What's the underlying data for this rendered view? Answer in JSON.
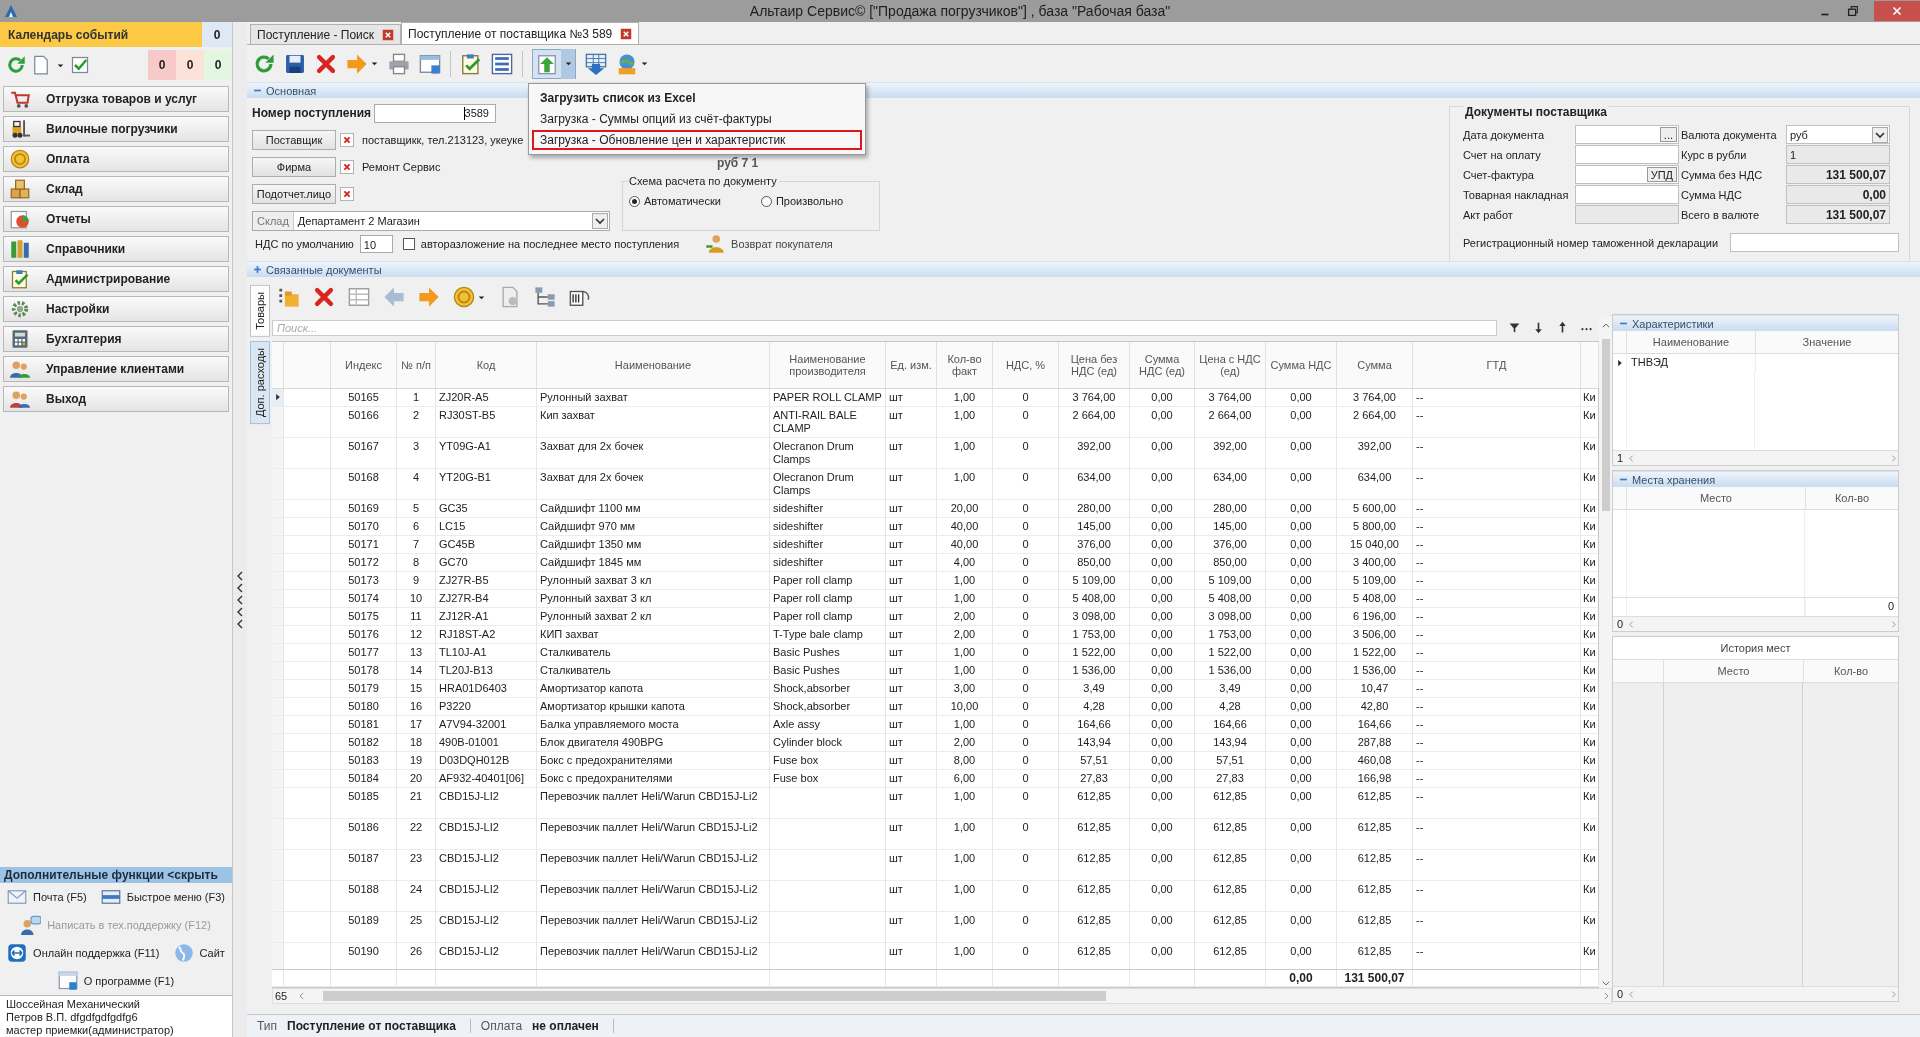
{
  "window": {
    "title": "Альтаир Сервис© [\"Продажа погрузчиков\"] , база \"Рабочая база\""
  },
  "sidebar": {
    "calendar": {
      "title": "Календарь событий",
      "count": "0"
    },
    "counters": [
      {
        "value": "0",
        "color": "#f7c9c9"
      },
      {
        "value": "0",
        "color": "#fce3da"
      },
      {
        "value": "0",
        "color": "#e2f6e2"
      }
    ],
    "nav": [
      {
        "label": "Отгрузка товаров и услуг"
      },
      {
        "label": "Вилочные погрузчики"
      },
      {
        "label": "Оплата"
      },
      {
        "label": "Склад"
      },
      {
        "label": "Отчеты"
      },
      {
        "label": "Справочники"
      },
      {
        "label": "Администрирование"
      },
      {
        "label": "Настройки"
      },
      {
        "label": "Бухгалтерия"
      },
      {
        "label": "Управление клиентами"
      },
      {
        "label": "Выход"
      }
    ],
    "extra": {
      "title": "Дополнительные функции <скрыть",
      "link_rows": [
        [
          {
            "label": "Почта (F5)",
            "disabled": false
          },
          {
            "label": "Быстрое меню (F3)",
            "disabled": false
          }
        ],
        [
          {
            "label": "Написать в тех.поддержку (F12)",
            "disabled": true
          }
        ],
        [
          {
            "label": "Онлайн поддержка (F11)",
            "disabled": false
          },
          {
            "label": "Сайт",
            "disabled": false
          }
        ],
        [
          {
            "label": "О программе (F1)",
            "disabled": false
          }
        ]
      ]
    },
    "user": [
      "Шоссейная Механический",
      "Петров В.П. dfgdfgdfgdfg6",
      "мастер приемки(администратор)"
    ]
  },
  "tabs": [
    {
      "label": "Поступление - Поиск",
      "selected": false
    },
    {
      "label": "Поступление от поставщика №3 589",
      "selected": true
    }
  ],
  "import_menu": {
    "items": [
      {
        "label": "Загрузить список из Excel",
        "default": true,
        "highlighted": false
      },
      {
        "label": "Загрузка - Суммы опций из счёт-фактуры",
        "default": false,
        "highlighted": false
      },
      {
        "label": "Загрузка - Обновление цен и характеристик",
        "default": false,
        "highlighted": true
      }
    ]
  },
  "main_section": {
    "title": "Основная",
    "expanded": true,
    "number": {
      "label": "Номер поступления",
      "value": "3589"
    },
    "parties": [
      {
        "button": "Поставщик",
        "value": "поставщикк, тел.213123, укеуке"
      },
      {
        "button": "Фирма",
        "value": "Ремонт Сервис"
      },
      {
        "button": "Подотчет.лицо"
      }
    ],
    "warehouse": {
      "label": "Склад",
      "value": "Департамент 2 Магазин"
    },
    "vat_default": {
      "label": "НДС по умолчанию",
      "value": "10"
    },
    "auto_split": {
      "label": "авторазложение на последнее место поступления",
      "checked": false
    },
    "customer_return": {
      "label": "Возврат покупателя"
    },
    "partial_text": "руб 7 1",
    "calc_scheme": {
      "title": "Схема расчета по документу",
      "options": [
        {
          "label": "Автоматически",
          "selected": true
        },
        {
          "label": "Произвольно",
          "selected": false
        }
      ]
    },
    "supplier_docs": {
      "title": "Документы поставщика",
      "left_fields": [
        {
          "label": "Дата документа",
          "kind": "date",
          "button": "..."
        },
        {
          "label": "Счет на оплату",
          "kind": "text"
        },
        {
          "label": "Счет-фактура",
          "kind": "text",
          "button": "УПД"
        },
        {
          "label": "Товарная накладная",
          "kind": "text"
        },
        {
          "label": "Акт работ",
          "kind": "readonly"
        }
      ],
      "right_fields": [
        {
          "label": "Валюта документа",
          "kind": "combo",
          "value": "руб"
        },
        {
          "label": "Курс в рубли",
          "kind": "readonly",
          "value": "1"
        },
        {
          "label": "Сумма без НДС",
          "kind": "total",
          "value": "131 500,07"
        },
        {
          "label": "Сумма НДС",
          "kind": "total",
          "value": "0,00"
        },
        {
          "label": "Всего в валюте",
          "kind": "total",
          "value": "131 500,07"
        }
      ],
      "customs": {
        "label": "Регистрационный номер таможенной декларации"
      }
    }
  },
  "related_section": {
    "title": "Связанные документы",
    "expanded": false
  },
  "goods": {
    "side_tabs": [
      {
        "label": "Товары",
        "selected": true
      },
      {
        "label": "Доп. расходы",
        "selected": false
      }
    ],
    "search": {
      "placeholder": "Поиск..."
    },
    "table": {
      "columns": [
        "Индекс",
        "№ п/п",
        "Код",
        "Наименование",
        "Наименование производителя",
        "Ед. изм.",
        "Кол-во факт",
        "НДС, %",
        "Цена без НДС (ед)",
        "Сумма НДС (ед)",
        "Цена с НДС (ед)",
        "Сумма НДС",
        "Сумма",
        "ГТД"
      ],
      "rows": [
        {
          "index": "50165",
          "no": "1",
          "code": "ZJ20R-A5",
          "name": "Рулонный захват",
          "maker": "PAPER ROLL CLAMP",
          "unit": "шт",
          "qty": "1,00",
          "vat": "0",
          "price": "3 764,00",
          "vat_unit": "0,00",
          "price_vat": "3 764,00",
          "vat_sum": "0,00",
          "sum": "3 764,00",
          "gtd": "--",
          "column_16": "Ки",
          "current": true,
          "tall": false
        },
        {
          "index": "50166",
          "no": "2",
          "code": "RJ30ST-B5",
          "name": "Кип захват",
          "maker": "ANTI-RAIL BALE CLAMP",
          "unit": "шт",
          "qty": "1,00",
          "vat": "0",
          "price": "2 664,00",
          "vat_unit": "0,00",
          "price_vat": "2 664,00",
          "vat_sum": "0,00",
          "sum": "2 664,00",
          "gtd": "--",
          "column_16": "Ки",
          "current": false,
          "tall": true
        },
        {
          "index": "50167",
          "no": "3",
          "code": "YT09G-A1",
          "name": "Захват для 2х бочек",
          "maker": "Olecranon Drum Clamps",
          "unit": "шт",
          "qty": "1,00",
          "vat": "0",
          "price": "392,00",
          "vat_unit": "0,00",
          "price_vat": "392,00",
          "vat_sum": "0,00",
          "sum": "392,00",
          "gtd": "--",
          "column_16": "Ки",
          "current": false,
          "tall": true
        },
        {
          "index": "50168",
          "no": "4",
          "code": "YT20G-B1",
          "name": "Захват для 2х бочек",
          "maker": "Olecranon Drum Clamps",
          "unit": "шт",
          "qty": "1,00",
          "vat": "0",
          "price": "634,00",
          "vat_unit": "0,00",
          "price_vat": "634,00",
          "vat_sum": "0,00",
          "sum": "634,00",
          "gtd": "--",
          "column_16": "Ки",
          "current": false,
          "tall": true
        },
        {
          "index": "50169",
          "no": "5",
          "code": "GC35",
          "name": "Сайдшифт 1100 мм",
          "maker": "sideshifter",
          "unit": "шт",
          "qty": "20,00",
          "vat": "0",
          "price": "280,00",
          "vat_unit": "0,00",
          "price_vat": "280,00",
          "vat_sum": "0,00",
          "sum": "5 600,00",
          "gtd": "--",
          "column_16": "Ки",
          "current": false,
          "tall": false
        },
        {
          "index": "50170",
          "no": "6",
          "code": "LC15",
          "name": "Сайдшифт 970 мм",
          "maker": "sideshifter",
          "unit": "шт",
          "qty": "40,00",
          "vat": "0",
          "price": "145,00",
          "vat_unit": "0,00",
          "price_vat": "145,00",
          "vat_sum": "0,00",
          "sum": "5 800,00",
          "gtd": "--",
          "column_16": "Ки",
          "current": false,
          "tall": false
        },
        {
          "index": "50171",
          "no": "7",
          "code": "GC45B",
          "name": "Сайдшифт 1350 мм",
          "maker": "sideshifter",
          "unit": "шт",
          "qty": "40,00",
          "vat": "0",
          "price": "376,00",
          "vat_unit": "0,00",
          "price_vat": "376,00",
          "vat_sum": "0,00",
          "sum": "15 040,00",
          "gtd": "--",
          "column_16": "Ки",
          "current": false,
          "tall": false
        },
        {
          "index": "50172",
          "no": "8",
          "code": "GC70",
          "name": "Сайдшифт 1845 мм",
          "maker": "sideshifter",
          "unit": "шт",
          "qty": "4,00",
          "vat": "0",
          "price": "850,00",
          "vat_unit": "0,00",
          "price_vat": "850,00",
          "vat_sum": "0,00",
          "sum": "3 400,00",
          "gtd": "--",
          "column_16": "Ки",
          "current": false,
          "tall": false
        },
        {
          "index": "50173",
          "no": "9",
          "code": "ZJ27R-B5",
          "name": "Рулонный захват 3 кл",
          "maker": "Paper roll clamp",
          "unit": "шт",
          "qty": "1,00",
          "vat": "0",
          "price": "5 109,00",
          "vat_unit": "0,00",
          "price_vat": "5 109,00",
          "vat_sum": "0,00",
          "sum": "5 109,00",
          "gtd": "--",
          "column_16": "Ки",
          "current": false,
          "tall": false
        },
        {
          "index": "50174",
          "no": "10",
          "code": "ZJ27R-B4",
          "name": "Рулонный захват 3 кл",
          "maker": "Paper roll clamp",
          "unit": "шт",
          "qty": "1,00",
          "vat": "0",
          "price": "5 408,00",
          "vat_unit": "0,00",
          "price_vat": "5 408,00",
          "vat_sum": "0,00",
          "sum": "5 408,00",
          "gtd": "--",
          "column_16": "Ки",
          "current": false,
          "tall": false
        },
        {
          "index": "50175",
          "no": "11",
          "code": "ZJ12R-A1",
          "name": "Рулонный захват 2 кл",
          "maker": "Paper roll clamp",
          "unit": "шт",
          "qty": "2,00",
          "vat": "0",
          "price": "3 098,00",
          "vat_unit": "0,00",
          "price_vat": "3 098,00",
          "vat_sum": "0,00",
          "sum": "6 196,00",
          "gtd": "--",
          "column_16": "Ки",
          "current": false,
          "tall": false
        },
        {
          "index": "50176",
          "no": "12",
          "code": "RJ18ST-A2",
          "name": "КИП захват",
          "maker": "T-Type bale clamp",
          "unit": "шт",
          "qty": "2,00",
          "vat": "0",
          "price": "1 753,00",
          "vat_unit": "0,00",
          "price_vat": "1 753,00",
          "vat_sum": "0,00",
          "sum": "3 506,00",
          "gtd": "--",
          "column_16": "Ки",
          "current": false,
          "tall": false
        },
        {
          "index": "50177",
          "no": "13",
          "code": "TL10J-A1",
          "name": "Сталкиватель",
          "maker": "Basic Pushes",
          "unit": "шт",
          "qty": "1,00",
          "vat": "0",
          "price": "1 522,00",
          "vat_unit": "0,00",
          "price_vat": "1 522,00",
          "vat_sum": "0,00",
          "sum": "1 522,00",
          "gtd": "--",
          "column_16": "Ки",
          "current": false,
          "tall": false
        },
        {
          "index": "50178",
          "no": "14",
          "code": "TL20J-B13",
          "name": "Сталкиватель",
          "maker": "Basic Pushes",
          "unit": "шт",
          "qty": "1,00",
          "vat": "0",
          "price": "1 536,00",
          "vat_unit": "0,00",
          "price_vat": "1 536,00",
          "vat_sum": "0,00",
          "sum": "1 536,00",
          "gtd": "--",
          "column_16": "Ки",
          "current": false,
          "tall": false
        },
        {
          "index": "50179",
          "no": "15",
          "code": "HRA01D6403",
          "name": "Амортизатор капота",
          "maker": "Shock,absorber",
          "unit": "шт",
          "qty": "3,00",
          "vat": "0",
          "price": "3,49",
          "vat_unit": "0,00",
          "price_vat": "3,49",
          "vat_sum": "0,00",
          "sum": "10,47",
          "gtd": "--",
          "column_16": "Ки",
          "current": false,
          "tall": false
        },
        {
          "index": "50180",
          "no": "16",
          "code": "P3220",
          "name": "Амортизатор крышки капота",
          "maker": "Shock,absorber",
          "unit": "шт",
          "qty": "10,00",
          "vat": "0",
          "price": "4,28",
          "vat_unit": "0,00",
          "price_vat": "4,28",
          "vat_sum": "0,00",
          "sum": "42,80",
          "gtd": "--",
          "column_16": "Ки",
          "current": false,
          "tall": false
        },
        {
          "index": "50181",
          "no": "17",
          "code": "A7V94-32001",
          "name": "Балка управляемого моста",
          "maker": "Axle assy",
          "unit": "шт",
          "qty": "1,00",
          "vat": "0",
          "price": "164,66",
          "vat_unit": "0,00",
          "price_vat": "164,66",
          "vat_sum": "0,00",
          "sum": "164,66",
          "gtd": "--",
          "column_16": "Ки",
          "current": false,
          "tall": false
        },
        {
          "index": "50182",
          "no": "18",
          "code": "490B-01001",
          "name": "Блок двигателя 490BPG",
          "maker": "Cylinder block",
          "unit": "шт",
          "qty": "2,00",
          "vat": "0",
          "price": "143,94",
          "vat_unit": "0,00",
          "price_vat": "143,94",
          "vat_sum": "0,00",
          "sum": "287,88",
          "gtd": "--",
          "column_16": "Ки",
          "current": false,
          "tall": false
        },
        {
          "index": "50183",
          "no": "19",
          "code": "D03DQH012B",
          "name": "Бокс с предохранителями",
          "maker": "Fuse box",
          "unit": "шт",
          "qty": "8,00",
          "vat": "0",
          "price": "57,51",
          "vat_unit": "0,00",
          "price_vat": "57,51",
          "vat_sum": "0,00",
          "sum": "460,08",
          "gtd": "--",
          "column_16": "Ки",
          "current": false,
          "tall": false
        },
        {
          "index": "50184",
          "no": "20",
          "code": "AF932-40401[06]",
          "name": "Бокс с предохранителями",
          "maker": "Fuse box",
          "unit": "шт",
          "qty": "6,00",
          "vat": "0",
          "price": "27,83",
          "vat_unit": "0,00",
          "price_vat": "27,83",
          "vat_sum": "0,00",
          "sum": "166,98",
          "gtd": "--",
          "column_16": "Ки",
          "current": false,
          "tall": false
        },
        {
          "index": "50185",
          "no": "21",
          "code": "CBD15J-LI2",
          "name": "Перевозчик паллет Heli/Warun CBD15J-Li2",
          "unit": "шт",
          "qty": "1,00",
          "vat": "0",
          "price": "612,85",
          "vat_unit": "0,00",
          "price_vat": "612,85",
          "vat_sum": "0,00",
          "sum": "612,85",
          "gtd": "--",
          "column_16": "Ки",
          "current": false,
          "tall": true
        },
        {
          "index": "50186",
          "no": "22",
          "code": "CBD15J-LI2",
          "name": "Перевозчик паллет Heli/Warun CBD15J-Li2",
          "unit": "шт",
          "qty": "1,00",
          "vat": "0",
          "price": "612,85",
          "vat_unit": "0,00",
          "price_vat": "612,85",
          "vat_sum": "0,00",
          "sum": "612,85",
          "gtd": "--",
          "column_16": "Ки",
          "current": false,
          "tall": true
        },
        {
          "index": "50187",
          "no": "23",
          "code": "CBD15J-LI2",
          "name": "Перевозчик паллет Heli/Warun CBD15J-Li2",
          "unit": "шт",
          "qty": "1,00",
          "vat": "0",
          "price": "612,85",
          "vat_unit": "0,00",
          "price_vat": "612,85",
          "vat_sum": "0,00",
          "sum": "612,85",
          "gtd": "--",
          "column_16": "Ки",
          "current": false,
          "tall": true
        },
        {
          "index": "50188",
          "no": "24",
          "code": "CBD15J-LI2",
          "name": "Перевозчик паллет Heli/Warun CBD15J-Li2",
          "unit": "шт",
          "qty": "1,00",
          "vat": "0",
          "price": "612,85",
          "vat_unit": "0,00",
          "price_vat": "612,85",
          "vat_sum": "0,00",
          "sum": "612,85",
          "gtd": "--",
          "column_16": "Ки",
          "current": false,
          "tall": true
        },
        {
          "index": "50189",
          "no": "25",
          "code": "CBD15J-LI2",
          "name": "Перевозчик паллет Heli/Warun CBD15J-Li2",
          "unit": "шт",
          "qty": "1,00",
          "vat": "0",
          "price": "612,85",
          "vat_unit": "0,00",
          "price_vat": "612,85",
          "vat_sum": "0,00",
          "sum": "612,85",
          "gtd": "--",
          "column_16": "Ки",
          "current": false,
          "tall": true
        },
        {
          "index": "50190",
          "no": "26",
          "code": "CBD15J-LI2",
          "name": "Перевозчик паллет Heli/Warun CBD15J-Li2",
          "unit": "шт",
          "qty": "1,00",
          "vat": "0",
          "price": "612,85",
          "vat_unit": "0,00",
          "price_vat": "612,85",
          "vat_sum": "0,00",
          "sum": "612,85",
          "gtd": "--",
          "column_16": "Ки",
          "current": false,
          "tall": true
        }
      ],
      "totals": {
        "vat_sum": "0,00",
        "sum": "131 500,07"
      },
      "row_count": "65"
    },
    "characteristics": {
      "title": "Характеристики",
      "expanded": true,
      "columns": [
        "Наименование",
        "Значение"
      ],
      "rows": [
        {
          "name": "ТНВЭД",
          "expanded": false
        }
      ],
      "pager": "1"
    },
    "storage": {
      "title": "Места хранения",
      "expanded": true,
      "columns": [
        "Место",
        "Кол-во"
      ],
      "total": "0",
      "pager": "0"
    },
    "history": {
      "title": "История мест",
      "columns": [
        "Место",
        "Кол-во"
      ],
      "pager": "0"
    }
  },
  "status_bar": [
    {
      "label": "Тип",
      "value": "Поступление от поставщика"
    },
    {
      "label": "Оплата",
      "value": "не оплачен"
    }
  ]
}
